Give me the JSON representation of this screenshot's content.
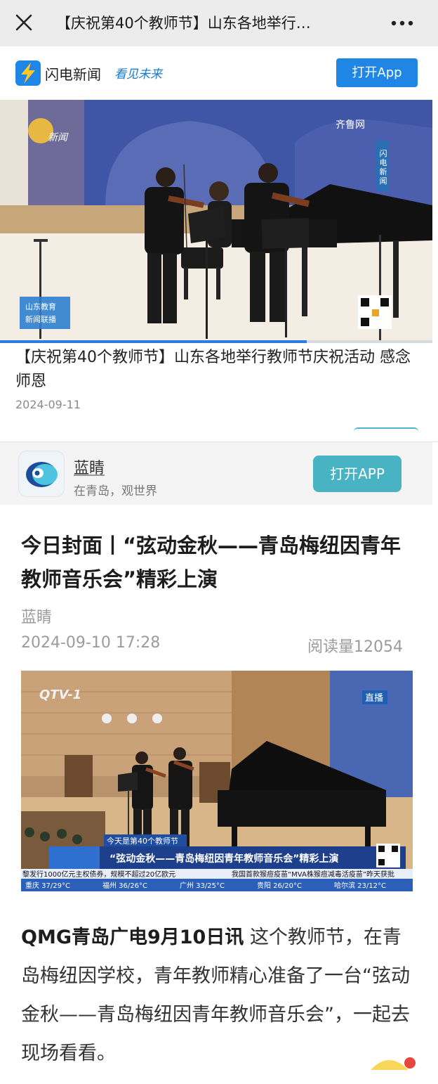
{
  "topbar": {
    "title": "【庆祝第40个教师节】山东各地举行…",
    "close_icon": "close-icon",
    "more_icon": "more-icon"
  },
  "shandian": {
    "name": "闪电新闻",
    "slogan": "看见未来",
    "open_label": "打开App",
    "brand_color": "#1f86e6"
  },
  "stage_video": {
    "watermark_left": "新闻",
    "watermark_right": "齐鲁网",
    "side_badge": "闪电新闻",
    "bottom_badge_line1": "山东教育",
    "bottom_badge_line2": "新闻联播",
    "progress": 0.71
  },
  "article1": {
    "title": "【庆祝第40个教师节】山东各地举行教师节庆祝活动 感念师恩",
    "date": "2024-09-11"
  },
  "lanqing": {
    "name": "蓝睛",
    "slogan": "在青岛，观世界",
    "open_label": "打开APP",
    "brand_color": "#47b3c3"
  },
  "article2": {
    "title": "今日封面丨“弦动金秋——青岛梅纽因青年教师音乐会”精彩上演",
    "source": "蓝睛",
    "datetime": "2024-09-10 17:28",
    "read_count": "阅读量12054",
    "video": {
      "channel_logo": "QTV-1",
      "live_badge": "直播",
      "topic_tag": "今天是第40个教师节",
      "headline": "“弦动金秋——青岛梅纽因青年教师音乐会”精彩上演",
      "ticker1": "黎发行1000亿元主权债券，规模不超过20亿欧元",
      "ticker2": "我国首款猴痘疫苗“MVA株猴痘减毒活疫苗”昨天获批",
      "weather": [
        "重庆 37/29°C",
        "福州 36/26°C",
        "广州 33/25°C",
        "贵阳 26/20°C",
        "哈尔滨 23/12°C"
      ]
    },
    "lead": "QMG青岛广电9月10日讯",
    "body": "这个教师节，在青岛梅纽因学校，青年教师精心准备了一台“弦动金秋——青岛梅纽因青年教师音乐会”，一起去现场看看。"
  }
}
